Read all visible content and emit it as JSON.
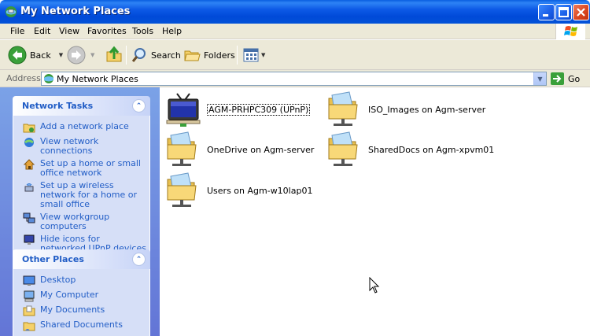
{
  "window": {
    "title": "My Network Places"
  },
  "menu": [
    "File",
    "Edit",
    "View",
    "Favorites",
    "Tools",
    "Help"
  ],
  "toolbar": {
    "back_label": "Back",
    "search_label": "Search",
    "folders_label": "Folders"
  },
  "address": {
    "label": "Address",
    "value": "My Network Places",
    "go_label": "Go"
  },
  "network_tasks": {
    "title": "Network Tasks",
    "items": [
      {
        "label": "Add a network place",
        "icon": "add-network-place-icon"
      },
      {
        "label": "View network connections",
        "icon": "network-connections-icon"
      },
      {
        "label": "Set up a home or small office network",
        "icon": "home-network-icon"
      },
      {
        "label": "Set up a wireless network for a home or small office",
        "icon": "wireless-network-icon"
      },
      {
        "label": "View workgroup computers",
        "icon": "workgroup-icon"
      },
      {
        "label": "Hide icons for networked UPnP devices",
        "icon": "upnp-icon"
      }
    ]
  },
  "other_places": {
    "title": "Other Places",
    "items": [
      {
        "label": "Desktop",
        "icon": "desktop-icon"
      },
      {
        "label": "My Computer",
        "icon": "my-computer-icon"
      },
      {
        "label": "My Documents",
        "icon": "my-documents-icon"
      },
      {
        "label": "Shared Documents",
        "icon": "shared-documents-icon"
      }
    ]
  },
  "places": [
    {
      "label": "AGM-PRHPC309 (UPnP)",
      "icon": "upnp-device-icon",
      "selected": true
    },
    {
      "label": "ISO_Images on Agm-server",
      "icon": "network-folder-icon",
      "selected": false
    },
    {
      "label": "OneDrive on Agm-server",
      "icon": "network-folder-icon",
      "selected": false
    },
    {
      "label": "SharedDocs on Agm-xpvm01",
      "icon": "network-folder-icon",
      "selected": false
    },
    {
      "label": "Users on Agm-w10lap01",
      "icon": "network-folder-icon",
      "selected": false
    }
  ]
}
